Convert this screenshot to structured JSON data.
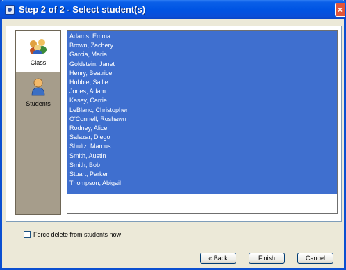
{
  "window": {
    "title": "Step 2 of 2 - Select student(s)",
    "close_glyph": "×"
  },
  "sidebar": {
    "items": [
      {
        "label": "Class",
        "icon": "class-group-icon",
        "selected": true
      },
      {
        "label": "Students",
        "icon": "student-icon",
        "selected": false
      }
    ]
  },
  "students": [
    "Adams, Emma",
    "Brown, Zachery",
    "Garcia, Maria",
    "Goldstein, Janet",
    "Henry, Beatrice",
    "Hubble, Sallie",
    "Jones, Adam",
    "Kasey, Carrie",
    "LeBlanc, Christopher",
    "O'Connell, Roshawn",
    "Rodney, Alice",
    "Salazar, Diego",
    "Shultz, Marcus",
    "Smith, Austin",
    "Smith, Bob",
    "Stuart, Parker",
    "Thompson, Abigail"
  ],
  "force_delete": {
    "label": "Force delete from students now",
    "checked": false
  },
  "buttons": {
    "back": "« Back",
    "finish": "Finish",
    "cancel": "Cancel"
  },
  "colors": {
    "selection": "#3f6fcf",
    "titlebar": "#0054e3",
    "sidebar": "#a69d8b"
  }
}
